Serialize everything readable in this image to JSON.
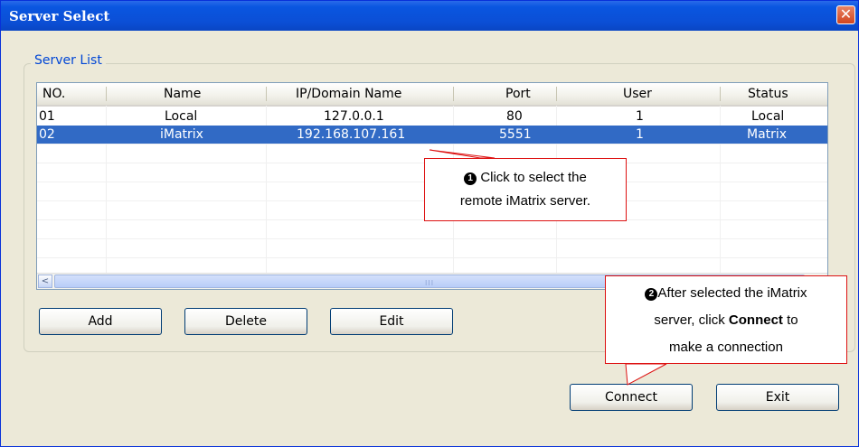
{
  "window": {
    "title": "Server Select",
    "close_glyph": "✕"
  },
  "group": {
    "label": "Server List"
  },
  "table": {
    "headers": [
      "NO.",
      "Name",
      "IP/Domain Name",
      "Port",
      "User",
      "Status"
    ],
    "rows": [
      [
        "01",
        "Local",
        "127.0.0.1",
        "80",
        "1",
        "Local"
      ],
      [
        "02",
        "iMatrix",
        "192.168.107.161",
        "5551",
        "1",
        "Matrix"
      ]
    ],
    "selected_row": 1
  },
  "scrollbar": {
    "left_arrow": "<",
    "grip": "III"
  },
  "buttons": {
    "add": "Add",
    "delete": "Delete",
    "edit": "Edit",
    "connect": "Connect",
    "exit": "Exit"
  },
  "callouts": {
    "one": {
      "marker": "1",
      "line1": "Click to select the",
      "line2": "remote iMatrix server."
    },
    "two": {
      "marker": "2",
      "line1": "After selected the iMatrix",
      "line2_pre": "server, click ",
      "line2_bold": "Connect",
      "line2_post": " to",
      "line3": "make a connection"
    }
  },
  "colors": {
    "selection": "#316ac5",
    "title_bar": "#0a56e0",
    "callout_border": "#dd1111",
    "group_label": "#0046d5"
  }
}
